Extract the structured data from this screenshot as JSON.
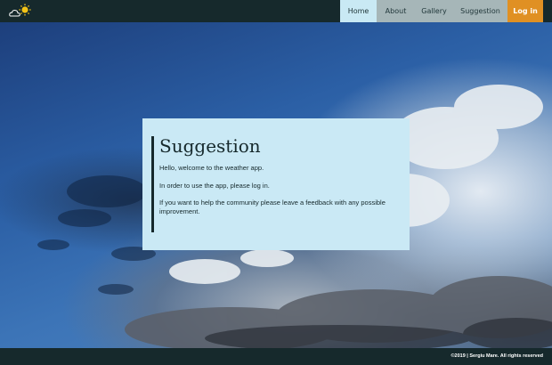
{
  "header": {
    "logo_icon": "cloud-sun-icon",
    "nav": {
      "home": "Home",
      "about": "About",
      "gallery": "Gallery",
      "suggestion": "Suggestion",
      "login": "Log in"
    },
    "colors": {
      "bar": "#16292c",
      "active": "#c9e9f4",
      "inactive": "#a6b6b8",
      "login": "#e09023"
    }
  },
  "card": {
    "title": "Suggestion",
    "p1": "Hello, welcome to the weather app.",
    "p2": "In order to use the app, please log in.",
    "p3": "If you want to help the community please leave a feedback with any possible improvement."
  },
  "footer": {
    "text": "©2019 | Sergiu Mare. All rights reserved"
  }
}
